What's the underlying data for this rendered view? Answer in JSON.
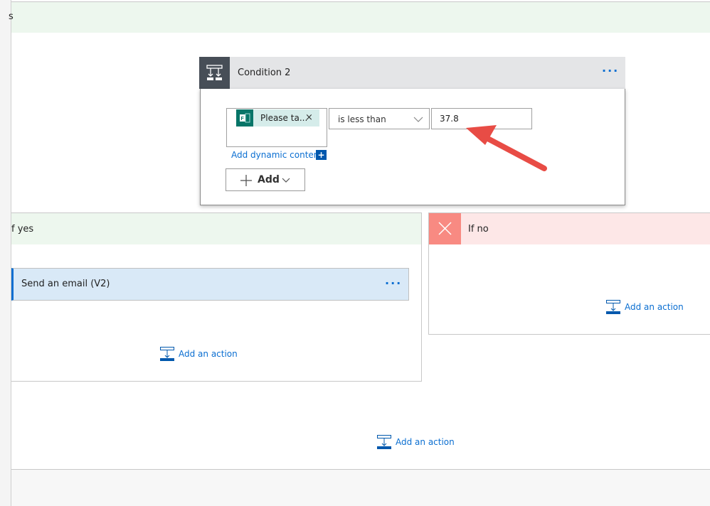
{
  "top_scope": {
    "title_fragment": "s"
  },
  "condition": {
    "title": "Condition 2",
    "menu": "···",
    "token": {
      "label": "Please ta...",
      "remove": "×",
      "icon": "forms-icon"
    },
    "operator": "is less than",
    "value": "37.8",
    "dynamic_content_link": "Add dynamic content",
    "add_button": "Add"
  },
  "if_yes": {
    "title": "f yes",
    "action": {
      "title": "Send an email (V2)",
      "menu": "···"
    },
    "add_action": "Add an action"
  },
  "if_no": {
    "title": "If no",
    "add_action": "Add an action"
  },
  "add_action": "Add an action",
  "colors": {
    "accent": "#0a6ed1",
    "yes_bg": "#edf7ee",
    "no_bg": "#fde7e7",
    "no_icon": "#f88a82",
    "annotation_arrow": "#e84c45"
  }
}
